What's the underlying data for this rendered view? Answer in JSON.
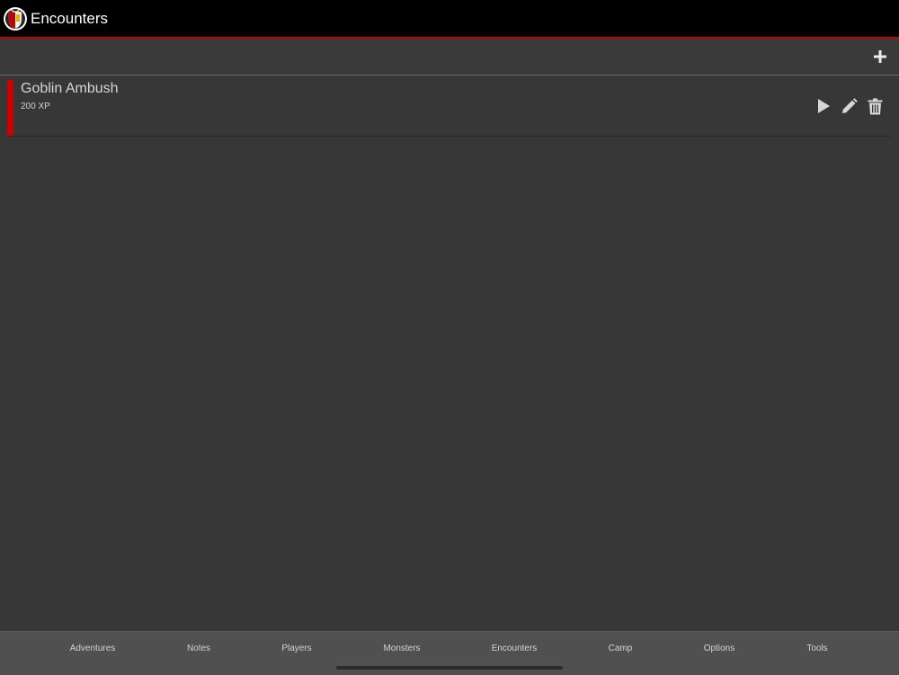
{
  "app": {
    "title": "Encounters",
    "logo_icon": "shield-logo-icon",
    "accent_color": "#c20000"
  },
  "toolbar": {
    "add_icon": "plus-icon"
  },
  "encounters": [
    {
      "name": "Goblin Ambush",
      "xp": "200 XP",
      "difficulty_color": "#cc0000",
      "actions": [
        "play-icon",
        "pencil-icon",
        "trash-icon"
      ]
    }
  ],
  "tabs": [
    {
      "label": "Adventures"
    },
    {
      "label": "Notes"
    },
    {
      "label": "Players"
    },
    {
      "label": "Monsters"
    },
    {
      "label": "Encounters"
    },
    {
      "label": "Camp"
    },
    {
      "label": "Options"
    },
    {
      "label": "Tools"
    }
  ]
}
